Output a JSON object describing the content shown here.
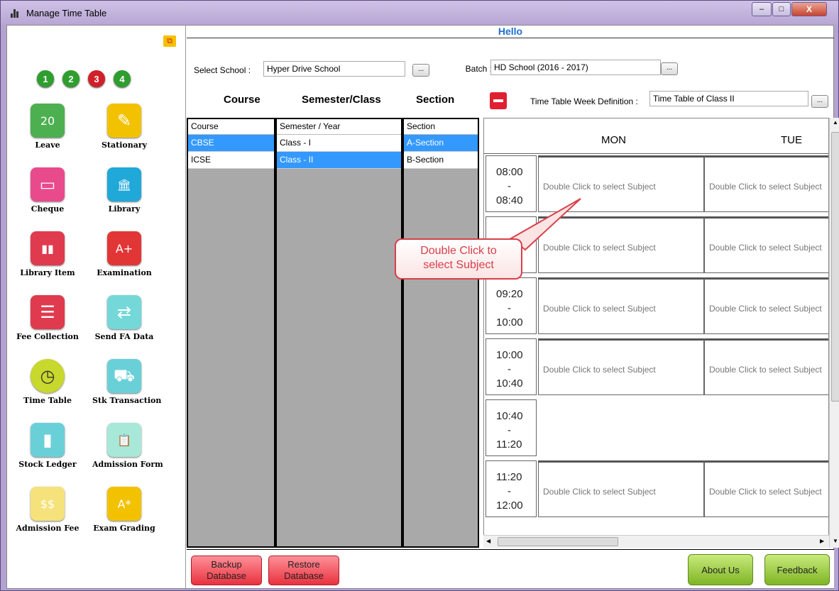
{
  "window": {
    "title": "Manage Time Table",
    "minimize": "–",
    "maximize": "□",
    "close": "X"
  },
  "sidebar": {
    "steps": [
      {
        "label": "1",
        "color": "#2e9e2e"
      },
      {
        "label": "2",
        "color": "#2e9e2e"
      },
      {
        "label": "3",
        "color": "#d0202a"
      },
      {
        "label": "4",
        "color": "#2e9e2e"
      }
    ],
    "tiles": [
      {
        "label": "Leave",
        "icon": "calendar-icon",
        "glyph": "20",
        "color": "#4caf50"
      },
      {
        "label": "Stationary",
        "icon": "stationery-icon",
        "glyph": "✎",
        "color": "#f2c200"
      },
      {
        "label": "Cheque",
        "icon": "cheque-icon",
        "glyph": "▭",
        "color": "#e94a8c"
      },
      {
        "label": "Library",
        "icon": "library-icon",
        "glyph": "🏛",
        "color": "#20a8d8"
      },
      {
        "label": "Library Item",
        "icon": "books-icon",
        "glyph": "▮▮",
        "color": "#e03a4e"
      },
      {
        "label": "Examination",
        "icon": "exam-sheet-icon",
        "glyph": "A+",
        "color": "#e23636"
      },
      {
        "label": "Fee Collection",
        "icon": "list-icon",
        "glyph": "☰",
        "color": "#e03a4e"
      },
      {
        "label": "Send FA Data",
        "icon": "transfer-icon",
        "glyph": "⇄",
        "color": "#74d8d8"
      },
      {
        "label": "Time Table",
        "icon": "clock-icon",
        "glyph": "◷",
        "color": "#c8d82c"
      },
      {
        "label": "Stk Transaction",
        "icon": "trolley-icon",
        "glyph": "⛟",
        "color": "#6ad0d8"
      },
      {
        "label": "Stock Ledger",
        "icon": "bar-chart-icon",
        "glyph": "▮",
        "color": "#6ad0d8"
      },
      {
        "label": "Admission Form",
        "icon": "clipboard-icon",
        "glyph": "📋",
        "color": "#a7e8d8"
      },
      {
        "label": "Admission Fee",
        "icon": "money-icon",
        "glyph": "$$",
        "color": "#f5e27a"
      },
      {
        "label": "Exam Grading",
        "icon": "grade-icon",
        "glyph": "A*",
        "color": "#f2c200"
      }
    ]
  },
  "main": {
    "hello": "Hello",
    "school_label": "Select School :",
    "school_value": "Hyper Drive School",
    "batch_label": "Batch :",
    "batch_value": "HD School (2016 - 2017)",
    "browse": "...",
    "course_header": "Course",
    "semester_header": "Semester/Class",
    "section_header": "Section",
    "week_def_label": "Time Table Week Definition :",
    "week_def_value": "Time Table of Class II"
  },
  "course_list": {
    "header": "Course",
    "items": [
      "CBSE",
      "ICSE"
    ],
    "selected": 0
  },
  "semester_list": {
    "header": "Semester / Year",
    "items": [
      "Class - I",
      "Class - II"
    ],
    "selected": 1
  },
  "section_list": {
    "header": "Section",
    "items": [
      "A-Section",
      "B-Section"
    ],
    "selected": 0
  },
  "timetable": {
    "days": [
      "MON",
      "TUE"
    ],
    "placeholder": "Double Click to select Subject",
    "slots": [
      {
        "start": "08:00",
        "sep": "-",
        "end": "08:40",
        "has_cells": true
      },
      {
        "start": "",
        "sep": "",
        "end": "09:20",
        "has_cells": true
      },
      {
        "start": "09:20",
        "sep": "-",
        "end": "10:00",
        "has_cells": true
      },
      {
        "start": "10:00",
        "sep": "-",
        "end": "10:40",
        "has_cells": true
      },
      {
        "start": "10:40",
        "sep": "-",
        "end": "11:20",
        "has_cells": false
      },
      {
        "start": "11:20",
        "sep": "-",
        "end": "12:00",
        "has_cells": true
      }
    ]
  },
  "callout": {
    "text": "Double Click to select Subject"
  },
  "bottom": {
    "backup": "Backup Database",
    "restore": "Restore Database",
    "about": "About Us",
    "feedback": "Feedback"
  }
}
